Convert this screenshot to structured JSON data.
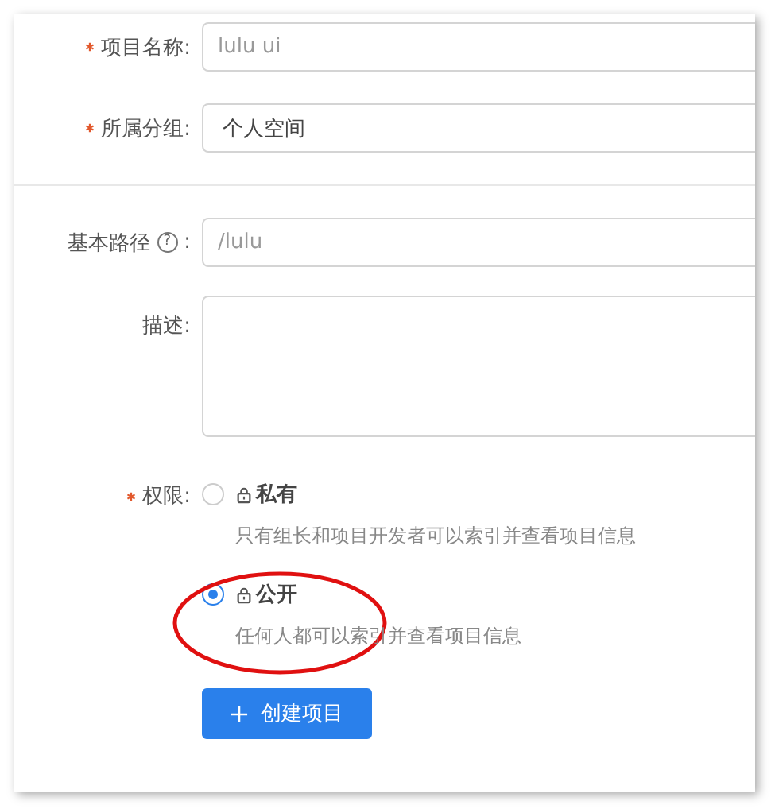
{
  "sections": [
    {
      "fields": [
        {
          "label": "项目名称:",
          "required": true,
          "kind": "input",
          "placeholder": "lulu ui"
        },
        {
          "label": "所属分组:",
          "required": true,
          "kind": "select",
          "value": "个人空间"
        }
      ]
    },
    {
      "fields": [
        {
          "label": "基本路径",
          "help": "?",
          "label_suffix": ":",
          "required": false,
          "kind": "input",
          "placeholder": "/lulu"
        },
        {
          "label": "描述:",
          "required": false,
          "kind": "textarea"
        }
      ]
    }
  ],
  "permission": {
    "label": "权限:",
    "required": true,
    "options": [
      {
        "label": "私有",
        "description": "只有组长和项目开发者可以索引并查看项目信息",
        "selected": false
      },
      {
        "label": "公开",
        "description": "任何人都可以索引并查看项目信息",
        "selected": true
      }
    ]
  },
  "submit": {
    "label": "创建项目"
  }
}
